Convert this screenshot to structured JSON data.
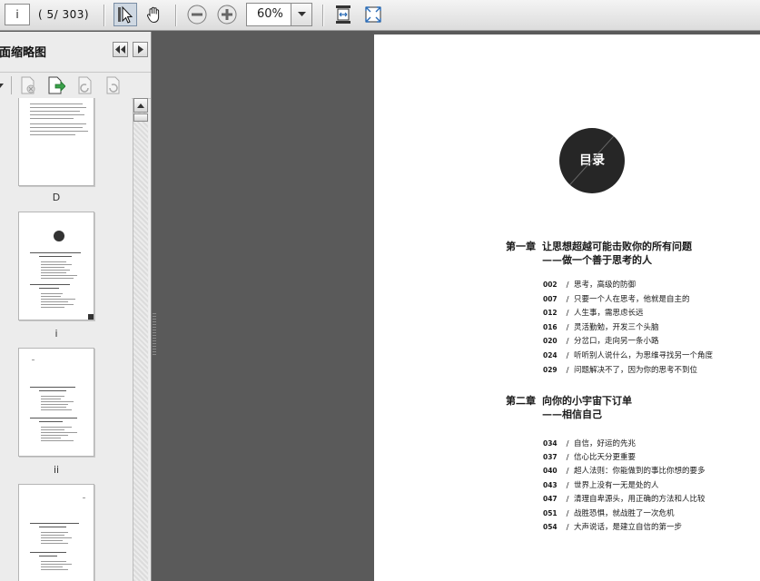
{
  "toolbar": {
    "page_input": "i",
    "page_count": "( 5/ 303)",
    "zoom": "60%"
  },
  "panel": {
    "title": "页面缩略图",
    "thumb_labels": [
      "D",
      "i",
      "ii"
    ]
  },
  "document": {
    "badge": "目录",
    "chapters": [
      {
        "num": "第一章",
        "title": "让思想超越可能击败你的所有问题",
        "subtitle": "——做一个善于思考的人",
        "entries": [
          {
            "page": "002",
            "text": "思考，高级的防御"
          },
          {
            "page": "007",
            "text": "只要一个人在思考，他就是自主的"
          },
          {
            "page": "012",
            "text": "人生事，需思虑长远"
          },
          {
            "page": "016",
            "text": "灵活勤勉，开发三个头脑"
          },
          {
            "page": "020",
            "text": "分岔口，走向另一条小路"
          },
          {
            "page": "024",
            "text": "听听别人说什么，为思维寻找另一个角度"
          },
          {
            "page": "029",
            "text": "问题解决不了，因为你的思考不到位"
          }
        ]
      },
      {
        "num": "第二章",
        "title": "向你的小宇宙下订单",
        "subtitle": "——相信自己",
        "entries": [
          {
            "page": "034",
            "text": "自信，好运的先兆"
          },
          {
            "page": "037",
            "text": "信心比天分更重要"
          },
          {
            "page": "040",
            "text": "超人法则：你能做到的事比你想的要多"
          },
          {
            "page": "043",
            "text": "世界上没有一无是处的人"
          },
          {
            "page": "047",
            "text": "清理自卑源头，用正确的方法和人比较"
          },
          {
            "page": "051",
            "text": "战胜恐惧，就战胜了一次危机"
          },
          {
            "page": "054",
            "text": "大声说话，是建立自信的第一步"
          }
        ]
      }
    ]
  }
}
